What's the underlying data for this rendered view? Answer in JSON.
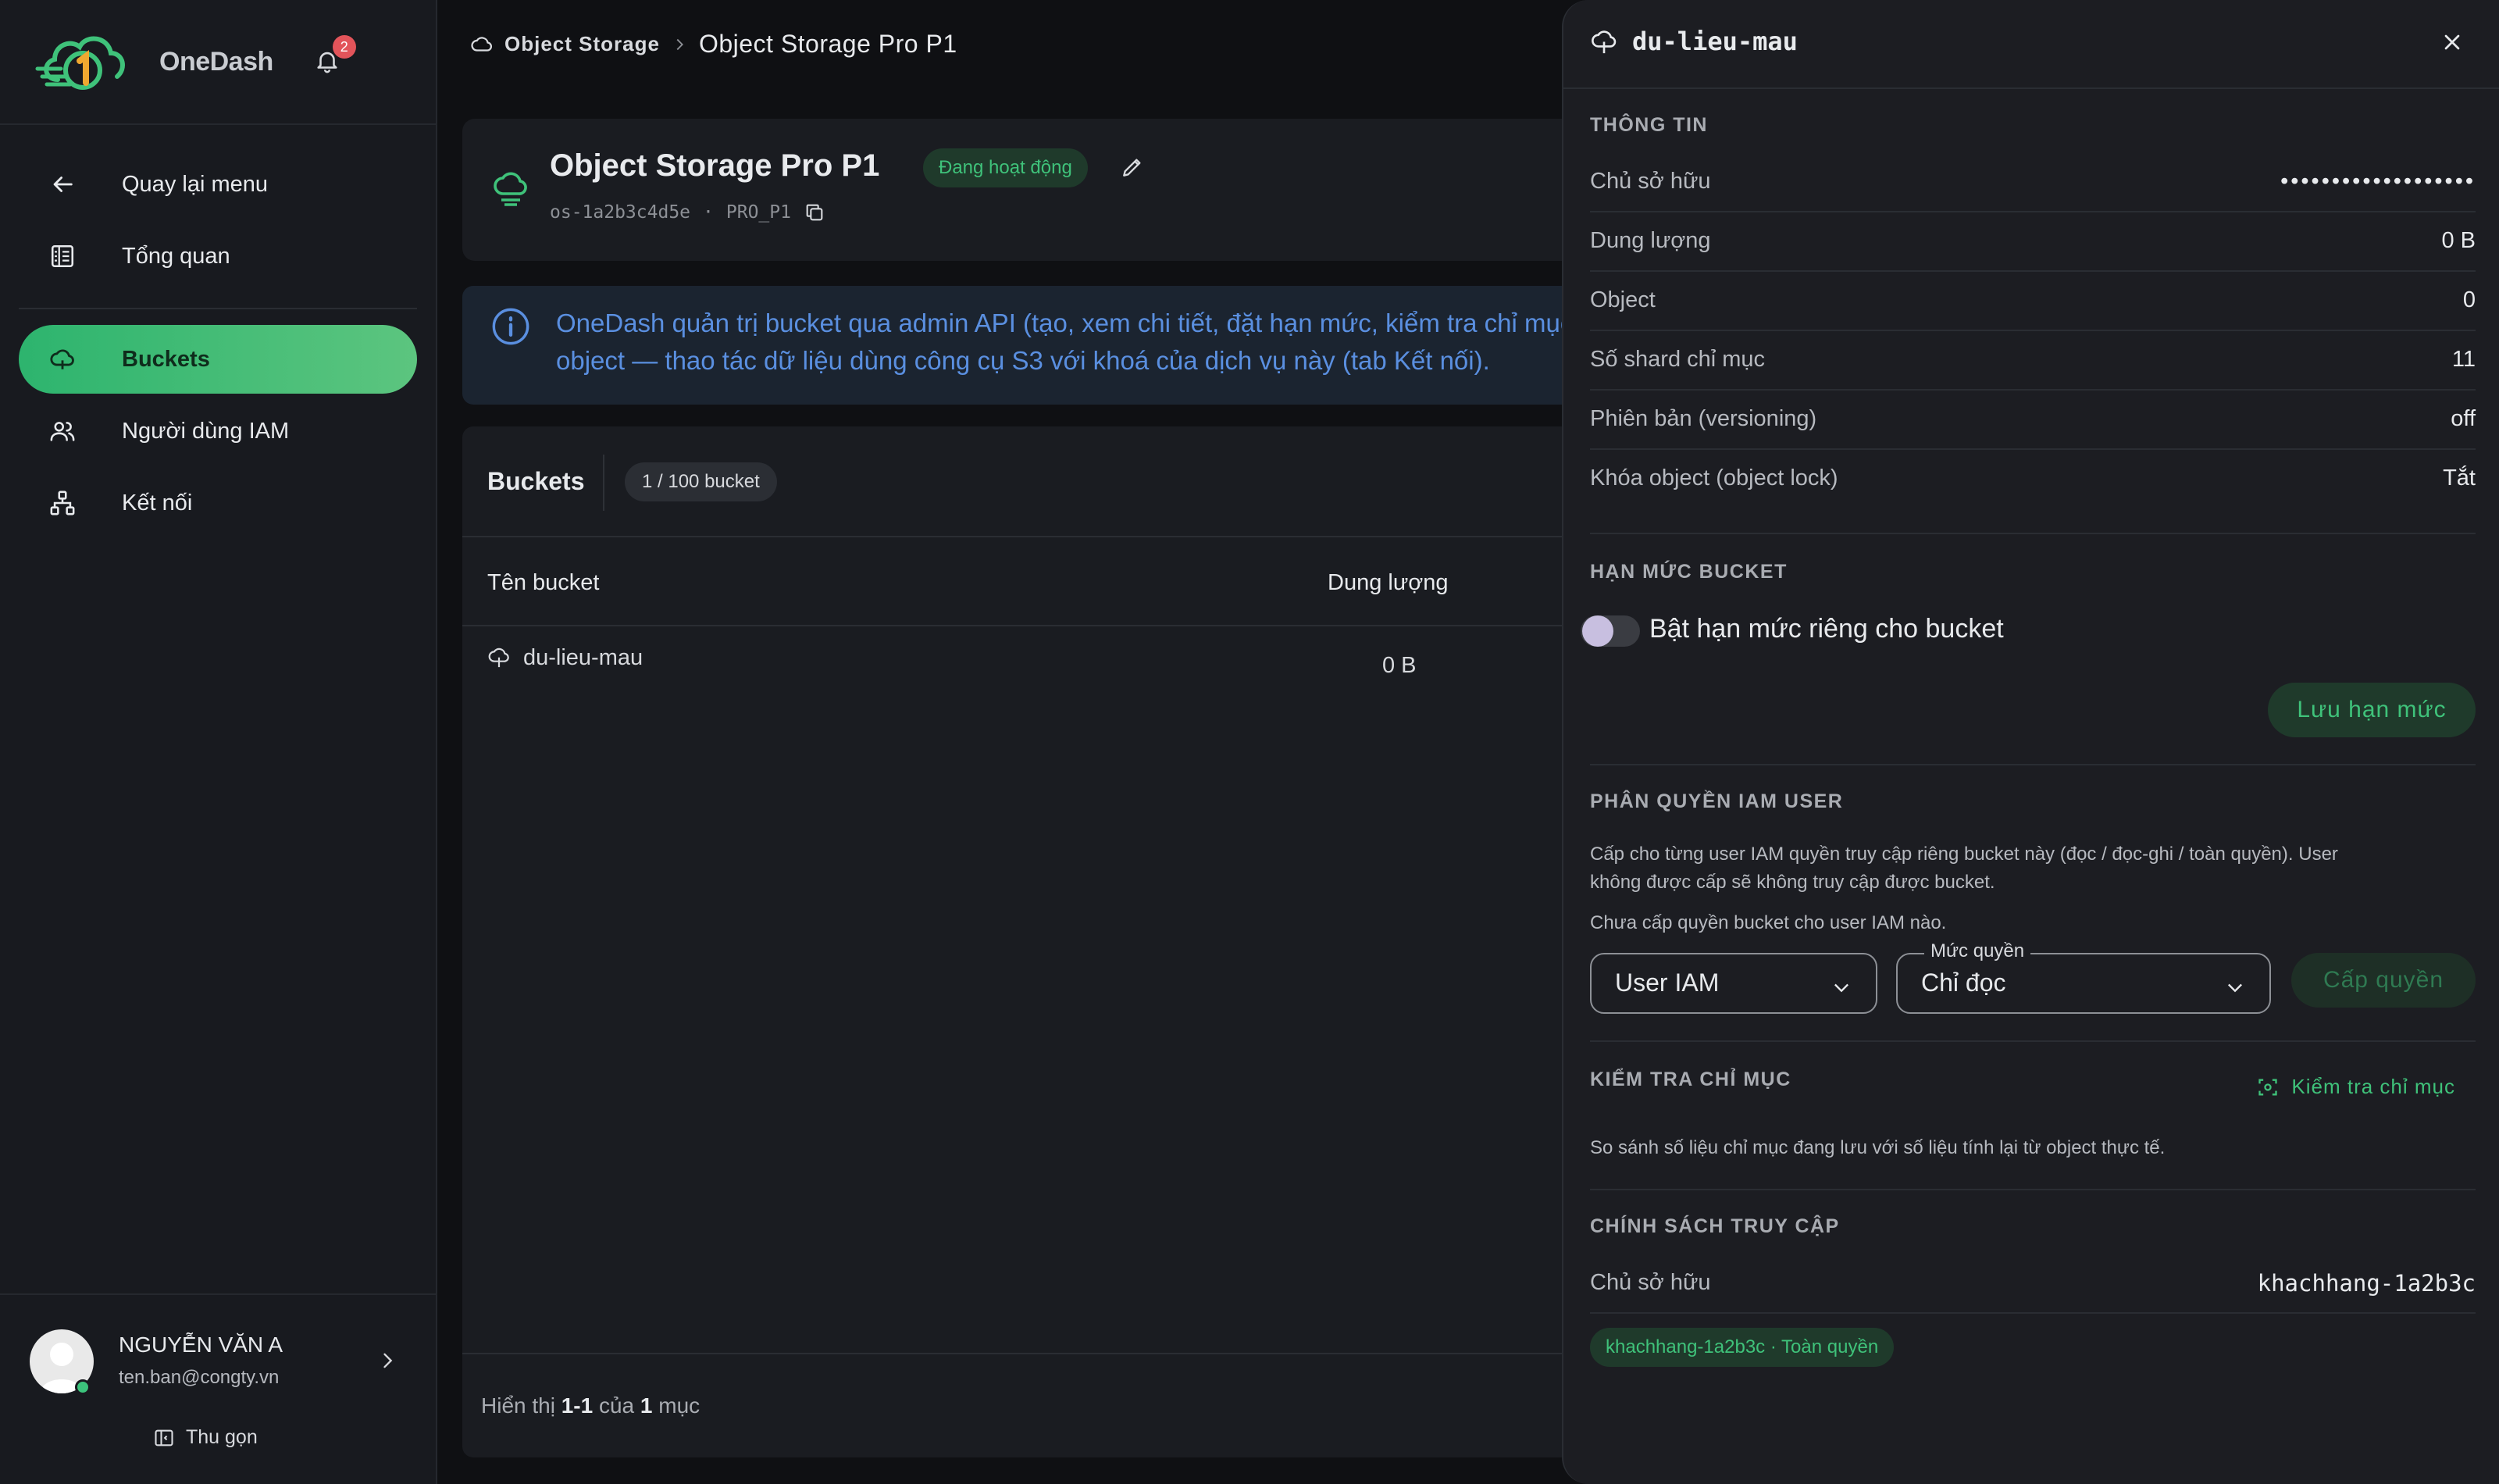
{
  "sidebar": {
    "brand_name": "OneDash",
    "notification_count": "2",
    "items": [
      {
        "label": "Quay lại menu",
        "icon": "arrow-left-icon"
      },
      {
        "label": "Tổng quan",
        "icon": "dashboard-icon"
      },
      {
        "label": "Buckets",
        "icon": "bucket-icon",
        "active": true
      },
      {
        "label": "Người dùng IAM",
        "icon": "users-icon"
      },
      {
        "label": "Kết nối",
        "icon": "network-icon"
      }
    ],
    "user": {
      "name": "NGUYỄN VĂN A",
      "email": "ten.ban@congty.vn"
    },
    "collapse_label": "Thu gọn"
  },
  "breadcrumb": {
    "root": "Object Storage",
    "current": "Object Storage Pro P1"
  },
  "service": {
    "title": "Object Storage Pro P1",
    "status": "Đang hoạt động",
    "id": "os-1a2b3c4d5e",
    "separator": "·",
    "plan": "PRO_P1"
  },
  "info_banner": {
    "line1": "OneDash quản trị bucket qua admin API (tạo, xem chi tiết, đặt hạn mức, kiểm tra chỉ mục, phân quyền) — không đọc/ghi",
    "line2": "object — thao tác dữ liệu dùng công cụ S3 với khoá của dịch vụ này (tab Kết nối)."
  },
  "buckets_table": {
    "title": "Buckets",
    "count_badge": "1 / 100 bucket",
    "columns": {
      "name": "Tên bucket",
      "size": "Dung lượng"
    },
    "rows": [
      {
        "name": "du-lieu-mau",
        "size": "0 B"
      }
    ],
    "footer": {
      "prefix": "Hiển thị ",
      "range": "1-1",
      "mid": " của ",
      "total": "1",
      "suffix": " mục"
    }
  },
  "drawer": {
    "title": "du-lieu-mau",
    "info_section": "THÔNG TIN",
    "info": [
      {
        "key": "Chủ sở hữu",
        "value": "•••••••••••••••••••"
      },
      {
        "key": "Dung lượng",
        "value": "0 B"
      },
      {
        "key": "Object",
        "value": "0"
      },
      {
        "key": "Số shard chỉ mục",
        "value": "11"
      },
      {
        "key": "Phiên bản (versioning)",
        "value": "off"
      },
      {
        "key": "Khóa object (object lock)",
        "value": "Tắt"
      }
    ],
    "quota_section": "HẠN MỨC BUCKET",
    "quota_toggle_label": "Bật hạn mức riêng cho bucket",
    "quota_enabled": false,
    "save_quota_label": "Lưu hạn mức",
    "iam_section": "PHÂN QUYỀN IAM USER",
    "iam_desc1": "Cấp cho từng user IAM quyền truy cập riêng bucket này (đọc / đọc-ghi / toàn quyền). User",
    "iam_desc2": "không được cấp sẽ không truy cập được bucket.",
    "iam_empty": "Chưa cấp quyền bucket cho user IAM nào.",
    "iam_user_select": "User IAM",
    "permission_legend": "Mức quyền",
    "permission_select": "Chỉ đọc",
    "grant_label": "Cấp quyền",
    "index_section": "KIỂM TRA CHỈ MỤC",
    "index_button": "Kiểm tra chỉ mục",
    "index_desc": "So sánh số liệu chỉ mục đang lưu với số liệu tính lại từ object thực tế.",
    "policy_section": "CHÍNH SÁCH TRUY CẬP",
    "policy_owner_key": "Chủ sở hữu",
    "policy_owner_value": "khachhang-1a2b3c",
    "policy_tag": "khachhang-1a2b3c · Toàn quyền"
  },
  "colors": {
    "accent": "#3fc27a",
    "active_nav": "#4cbf78",
    "link_blue": "#5a8fe0"
  }
}
